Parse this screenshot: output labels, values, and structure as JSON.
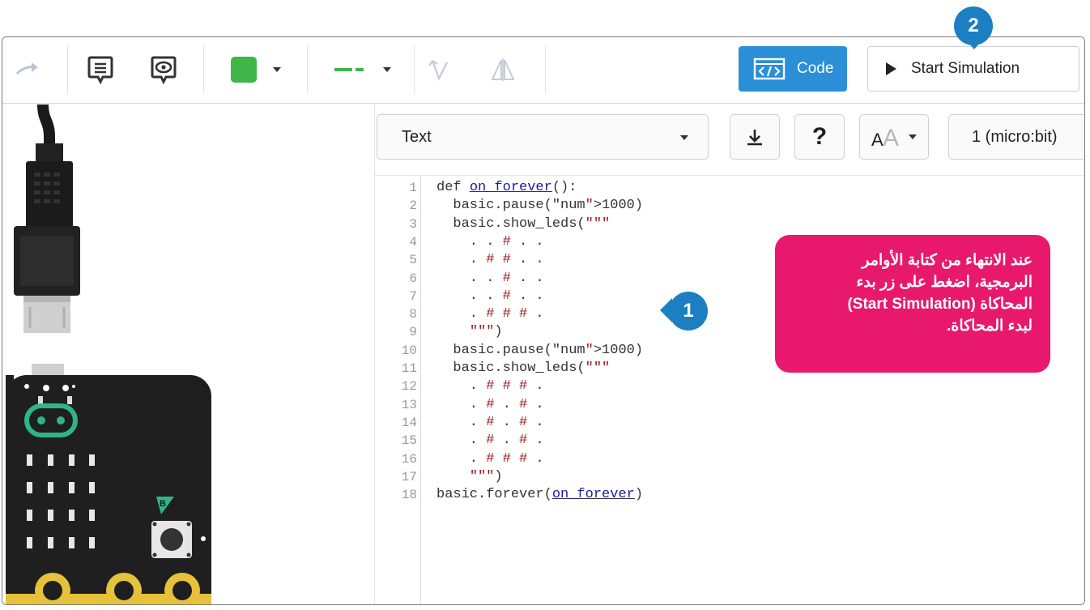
{
  "toolbar": {
    "redo_icon": "redo-arrow-icon",
    "notes_icon": "notes-icon",
    "notes_view_icon": "notes-view-icon",
    "fill_color": "#3fb648",
    "line_color": "#3fb648",
    "code_label": "Code",
    "code_button_color": "#2b8fd8",
    "start_simulation_label": "Start Simulation"
  },
  "editor": {
    "language": "Text",
    "device": "1 (micro:bit)",
    "help_label": "?",
    "code_lines": [
      {
        "n": "1",
        "text": "def on_forever():"
      },
      {
        "n": "2",
        "text": "  basic.pause(1000)"
      },
      {
        "n": "3",
        "text": "  basic.show_leds(\"\"\""
      },
      {
        "n": "4",
        "text": "    . . # . ."
      },
      {
        "n": "5",
        "text": "    . # # . ."
      },
      {
        "n": "6",
        "text": "    . . # . ."
      },
      {
        "n": "7",
        "text": "    . . # . ."
      },
      {
        "n": "8",
        "text": "    . # # # ."
      },
      {
        "n": "9",
        "text": "    \"\"\")"
      },
      {
        "n": "10",
        "text": "  basic.pause(1000)"
      },
      {
        "n": "11",
        "text": "  basic.show_leds(\"\"\""
      },
      {
        "n": "12",
        "text": "    . # # # ."
      },
      {
        "n": "13",
        "text": "    . # . # ."
      },
      {
        "n": "14",
        "text": "    . # . # ."
      },
      {
        "n": "15",
        "text": "    . # . # ."
      },
      {
        "n": "16",
        "text": "    . # # # ."
      },
      {
        "n": "17",
        "text": "    \"\"\")"
      },
      {
        "n": "18",
        "text": "basic.forever(on_forever)"
      }
    ]
  },
  "callouts": {
    "step1": "1",
    "step2": "2",
    "note_lines": [
      "عند الانتهاء من كتابة الأوامر",
      "البرمجية، اضغط على زر بدء",
      "المحاكاة (Start Simulation)",
      "لبدء المحاكاة."
    ],
    "note_color": "#e8196c",
    "bubble_color": "#1c7fc1"
  },
  "microbit": {
    "button_label": "B",
    "board_color": "#1f1f1f",
    "accent_color": "#2fb58a",
    "pin_color": "#e5c23a"
  }
}
